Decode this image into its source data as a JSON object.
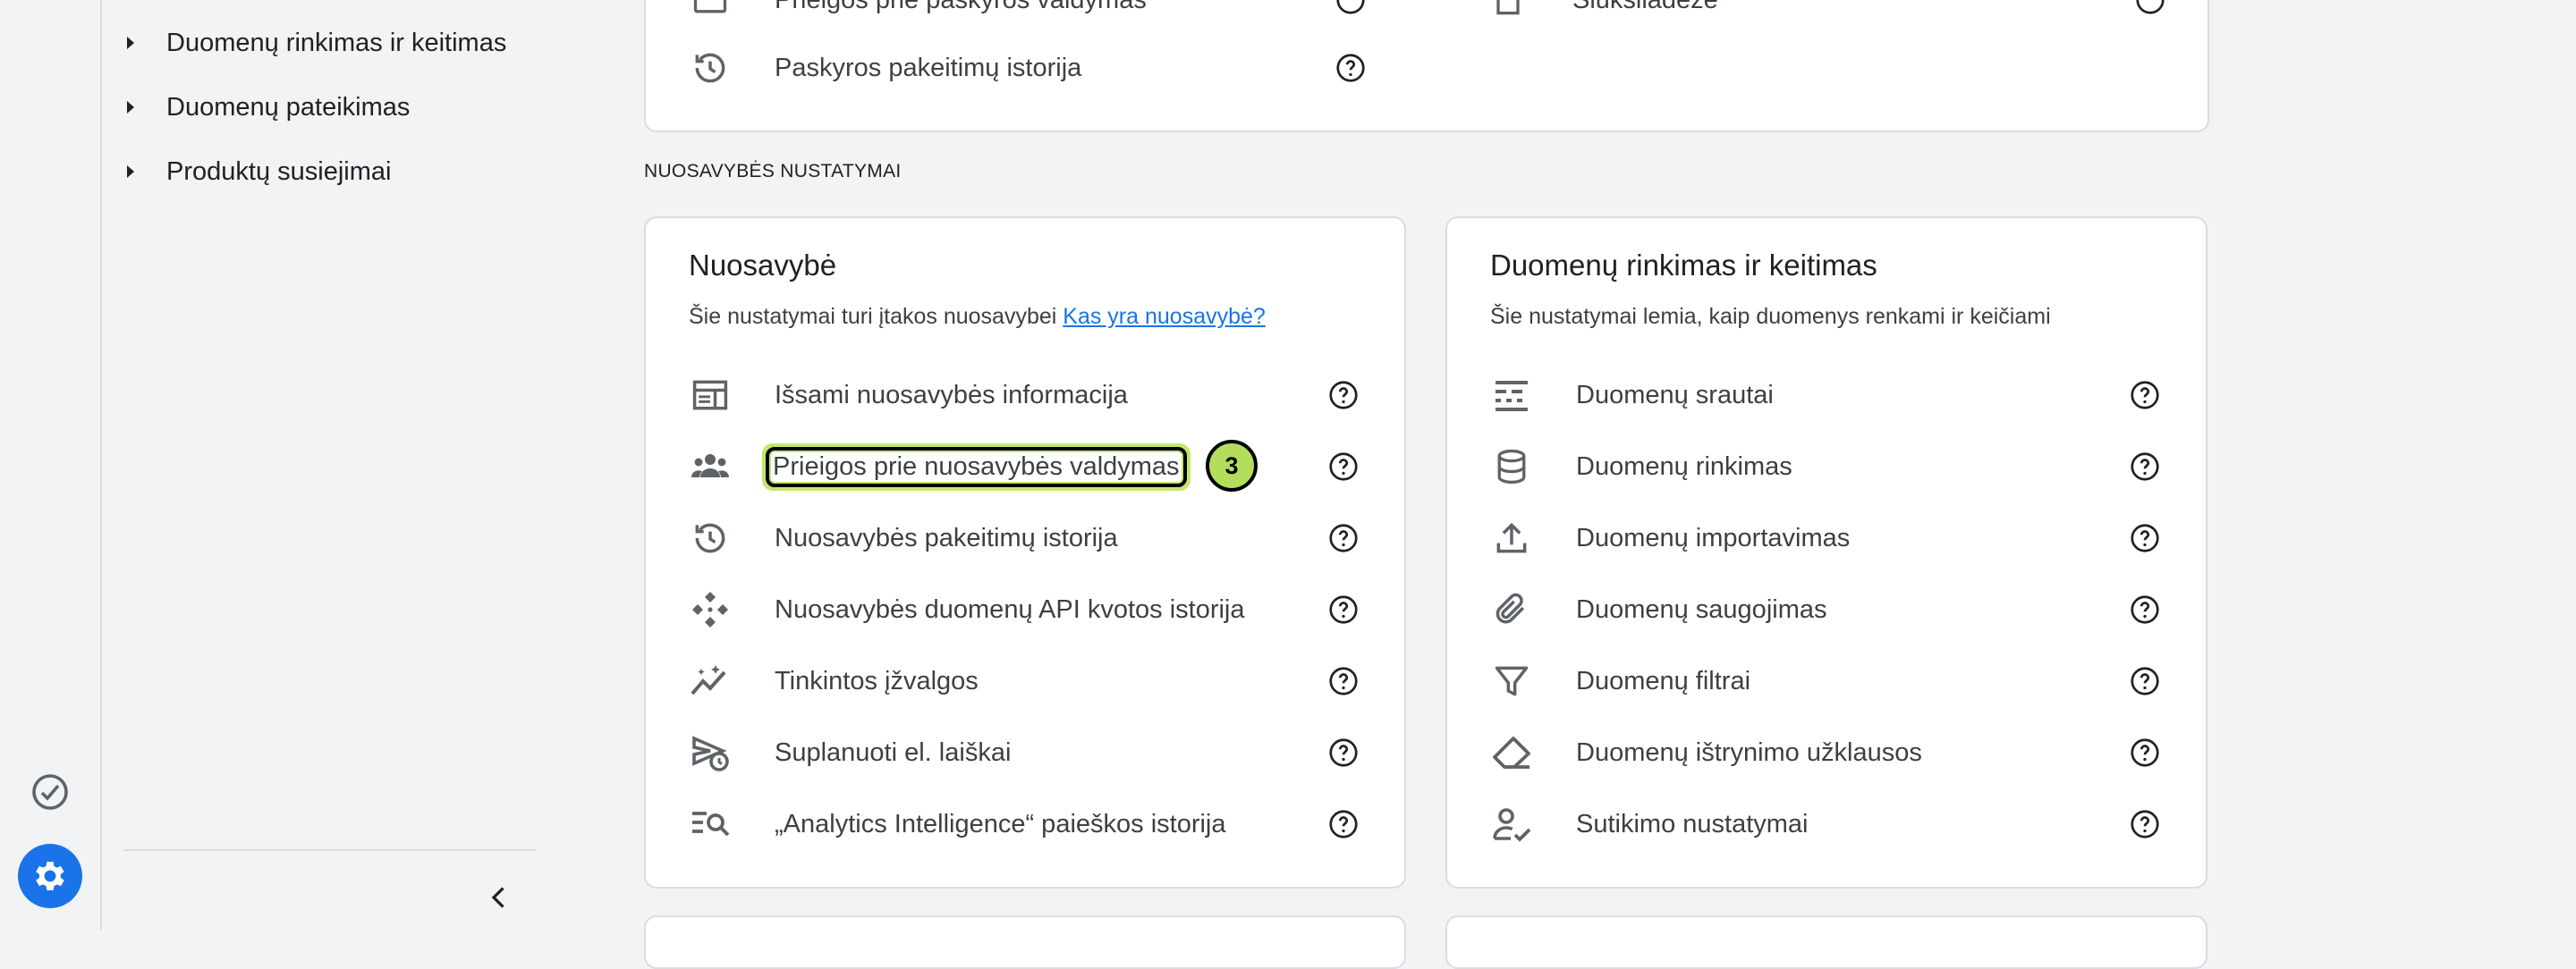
{
  "sidenav": {
    "items": [
      {
        "label": "Duomenų rinkimas ir keitimas"
      },
      {
        "label": "Duomenų pateikimas"
      },
      {
        "label": "Produktų susiejimai"
      }
    ]
  },
  "account_card": {
    "rows": [
      {
        "label": "Prieigos prie paskyros valdymas",
        "icon": "people-icon"
      },
      {
        "label": "Paskyros pakeitimų istorija",
        "icon": "history-icon"
      }
    ],
    "right_rows": [
      {
        "label": "Šiukšliadėžė",
        "icon": "trash-icon"
      }
    ]
  },
  "section_label": "NUOSAVYBĖS NUSTATYMAI",
  "property_card": {
    "title": "Nuosavybė",
    "subtitle": "Šie nustatymai turi įtakos nuosavybei",
    "link": "Kas yra nuosavybė?",
    "rows": [
      {
        "label": "Išsami nuosavybės informacija",
        "icon": "property-details-icon"
      },
      {
        "label": "Prieigos prie nuosavybės valdymas",
        "icon": "people-icon"
      },
      {
        "label": "Nuosavybės pakeitimų istorija",
        "icon": "history-icon"
      },
      {
        "label": "Nuosavybės duomenų API kvotos istorija",
        "icon": "api-icon"
      },
      {
        "label": "Tinkintos įžvalgos",
        "icon": "insights-icon"
      },
      {
        "label": "Suplanuoti el. laiškai",
        "icon": "scheduled-send-icon"
      },
      {
        "label": "„Analytics Intelligence“ paieškos istorija",
        "icon": "search-history-icon"
      }
    ]
  },
  "data_card": {
    "title": "Duomenų rinkimas ir keitimas",
    "subtitle": "Šie nustatymai lemia, kaip duomenys renkami ir keičiami",
    "rows": [
      {
        "label": "Duomenų srautai",
        "icon": "streams-icon"
      },
      {
        "label": "Duomenų rinkimas",
        "icon": "database-icon"
      },
      {
        "label": "Duomenų importavimas",
        "icon": "upload-icon"
      },
      {
        "label": "Duomenų saugojimas",
        "icon": "attachment-icon"
      },
      {
        "label": "Duomenų filtrai",
        "icon": "filter-icon"
      },
      {
        "label": "Duomenų ištrynimo užklausos",
        "icon": "eraser-icon"
      },
      {
        "label": "Sutikimo nustatymai",
        "icon": "consent-icon"
      }
    ]
  },
  "step_badge": "3",
  "colors": {
    "accent": "#1a73e8",
    "highlight": "#c5e66a"
  }
}
